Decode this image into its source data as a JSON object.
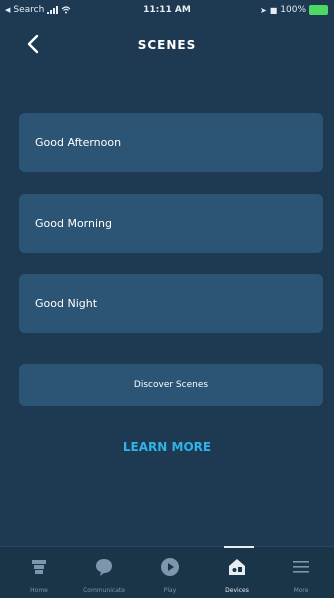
{
  "status_bar": {
    "carrier": "Search",
    "time": "11:11 AM",
    "battery": "100%"
  },
  "header": {
    "title": "SCENES"
  },
  "scenes": [
    {
      "label": "Good Afternoon"
    },
    {
      "label": "Good Morning"
    },
    {
      "label": "Good Night"
    }
  ],
  "discover_label": "Discover Scenes",
  "learn_more_label": "LEARN MORE",
  "tabs": [
    {
      "label": "Home",
      "icon": "home-icon"
    },
    {
      "label": "Communicate",
      "icon": "chat-bubble-icon"
    },
    {
      "label": "Play",
      "icon": "play-icon"
    },
    {
      "label": "Devices",
      "icon": "devices-icon",
      "active": true
    },
    {
      "label": "More",
      "icon": "menu-icon"
    }
  ],
  "colors": {
    "background": "#1d3a52",
    "card": "#2b5475",
    "accent": "#2fb3e8"
  }
}
